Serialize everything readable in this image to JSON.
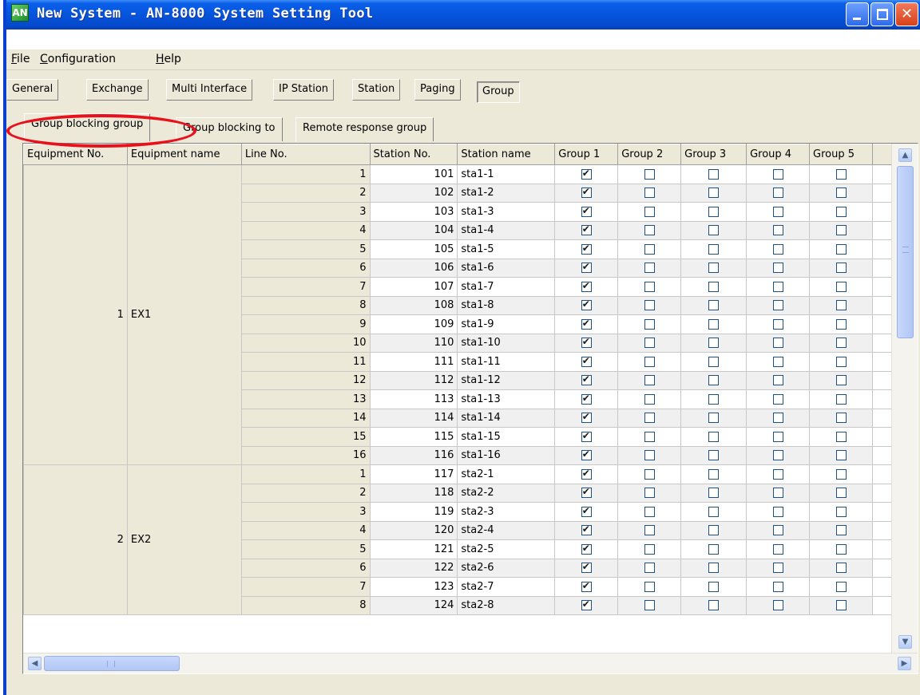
{
  "window": {
    "app_icon_text": "AN",
    "title": "New System - AN-8000 System Setting Tool"
  },
  "menu": [
    {
      "label": "File",
      "mnemonic": "F",
      "rest": "ile"
    },
    {
      "label": "Configuration",
      "mnemonic": "C",
      "rest": "onfiguration"
    },
    {
      "label": "Help",
      "mnemonic": "H",
      "rest": "elp"
    }
  ],
  "tabs": [
    "General",
    "Exchange",
    "Multi Interface",
    "IP Station",
    "Station",
    "Paging",
    "Group"
  ],
  "active_tab": "Group",
  "subtabs": [
    "Group blocking group",
    "Group blocking to",
    "Remote response group"
  ],
  "active_subtab": "Group blocking group",
  "columns": [
    "Equipment No.",
    "Equipment name",
    "Line No.",
    "Station No.",
    "Station name",
    "Group 1",
    "Group 2",
    "Group 3",
    "Group 4",
    "Group 5"
  ],
  "equipment": [
    {
      "no": "1",
      "name": "EX1",
      "rows": [
        {
          "line": "1",
          "station_no": "101",
          "station_name": "sta1-1",
          "groups": [
            true,
            false,
            false,
            false,
            false
          ]
        },
        {
          "line": "2",
          "station_no": "102",
          "station_name": "sta1-2",
          "groups": [
            true,
            false,
            false,
            false,
            false
          ]
        },
        {
          "line": "3",
          "station_no": "103",
          "station_name": "sta1-3",
          "groups": [
            true,
            false,
            false,
            false,
            false
          ]
        },
        {
          "line": "4",
          "station_no": "104",
          "station_name": "sta1-4",
          "groups": [
            true,
            false,
            false,
            false,
            false
          ]
        },
        {
          "line": "5",
          "station_no": "105",
          "station_name": "sta1-5",
          "groups": [
            true,
            false,
            false,
            false,
            false
          ]
        },
        {
          "line": "6",
          "station_no": "106",
          "station_name": "sta1-6",
          "groups": [
            true,
            false,
            false,
            false,
            false
          ]
        },
        {
          "line": "7",
          "station_no": "107",
          "station_name": "sta1-7",
          "groups": [
            true,
            false,
            false,
            false,
            false
          ]
        },
        {
          "line": "8",
          "station_no": "108",
          "station_name": "sta1-8",
          "groups": [
            true,
            false,
            false,
            false,
            false
          ]
        },
        {
          "line": "9",
          "station_no": "109",
          "station_name": "sta1-9",
          "groups": [
            true,
            false,
            false,
            false,
            false
          ]
        },
        {
          "line": "10",
          "station_no": "110",
          "station_name": "sta1-10",
          "groups": [
            true,
            false,
            false,
            false,
            false
          ]
        },
        {
          "line": "11",
          "station_no": "111",
          "station_name": "sta1-11",
          "groups": [
            true,
            false,
            false,
            false,
            false
          ]
        },
        {
          "line": "12",
          "station_no": "112",
          "station_name": "sta1-12",
          "groups": [
            true,
            false,
            false,
            false,
            false
          ]
        },
        {
          "line": "13",
          "station_no": "113",
          "station_name": "sta1-13",
          "groups": [
            true,
            false,
            false,
            false,
            false
          ]
        },
        {
          "line": "14",
          "station_no": "114",
          "station_name": "sta1-14",
          "groups": [
            true,
            false,
            false,
            false,
            false
          ]
        },
        {
          "line": "15",
          "station_no": "115",
          "station_name": "sta1-15",
          "groups": [
            true,
            false,
            false,
            false,
            false
          ]
        },
        {
          "line": "16",
          "station_no": "116",
          "station_name": "sta1-16",
          "groups": [
            true,
            false,
            false,
            false,
            false
          ]
        }
      ]
    },
    {
      "no": "2",
      "name": "EX2",
      "rows": [
        {
          "line": "1",
          "station_no": "117",
          "station_name": "sta2-1",
          "groups": [
            true,
            false,
            false,
            false,
            false
          ]
        },
        {
          "line": "2",
          "station_no": "118",
          "station_name": "sta2-2",
          "groups": [
            true,
            false,
            false,
            false,
            false
          ]
        },
        {
          "line": "3",
          "station_no": "119",
          "station_name": "sta2-3",
          "groups": [
            true,
            false,
            false,
            false,
            false
          ]
        },
        {
          "line": "4",
          "station_no": "120",
          "station_name": "sta2-4",
          "groups": [
            true,
            false,
            false,
            false,
            false
          ]
        },
        {
          "line": "5",
          "station_no": "121",
          "station_name": "sta2-5",
          "groups": [
            true,
            false,
            false,
            false,
            false
          ]
        },
        {
          "line": "6",
          "station_no": "122",
          "station_name": "sta2-6",
          "groups": [
            true,
            false,
            false,
            false,
            false
          ]
        },
        {
          "line": "7",
          "station_no": "123",
          "station_name": "sta2-7",
          "groups": [
            true,
            false,
            false,
            false,
            false
          ]
        },
        {
          "line": "8",
          "station_no": "124",
          "station_name": "sta2-8",
          "groups": [
            true,
            false,
            false,
            false,
            false
          ]
        }
      ]
    }
  ],
  "colors": {
    "titlebar": "#0654dc",
    "highlight_oval": "#e8101a",
    "window_face": "#ece9d8"
  }
}
